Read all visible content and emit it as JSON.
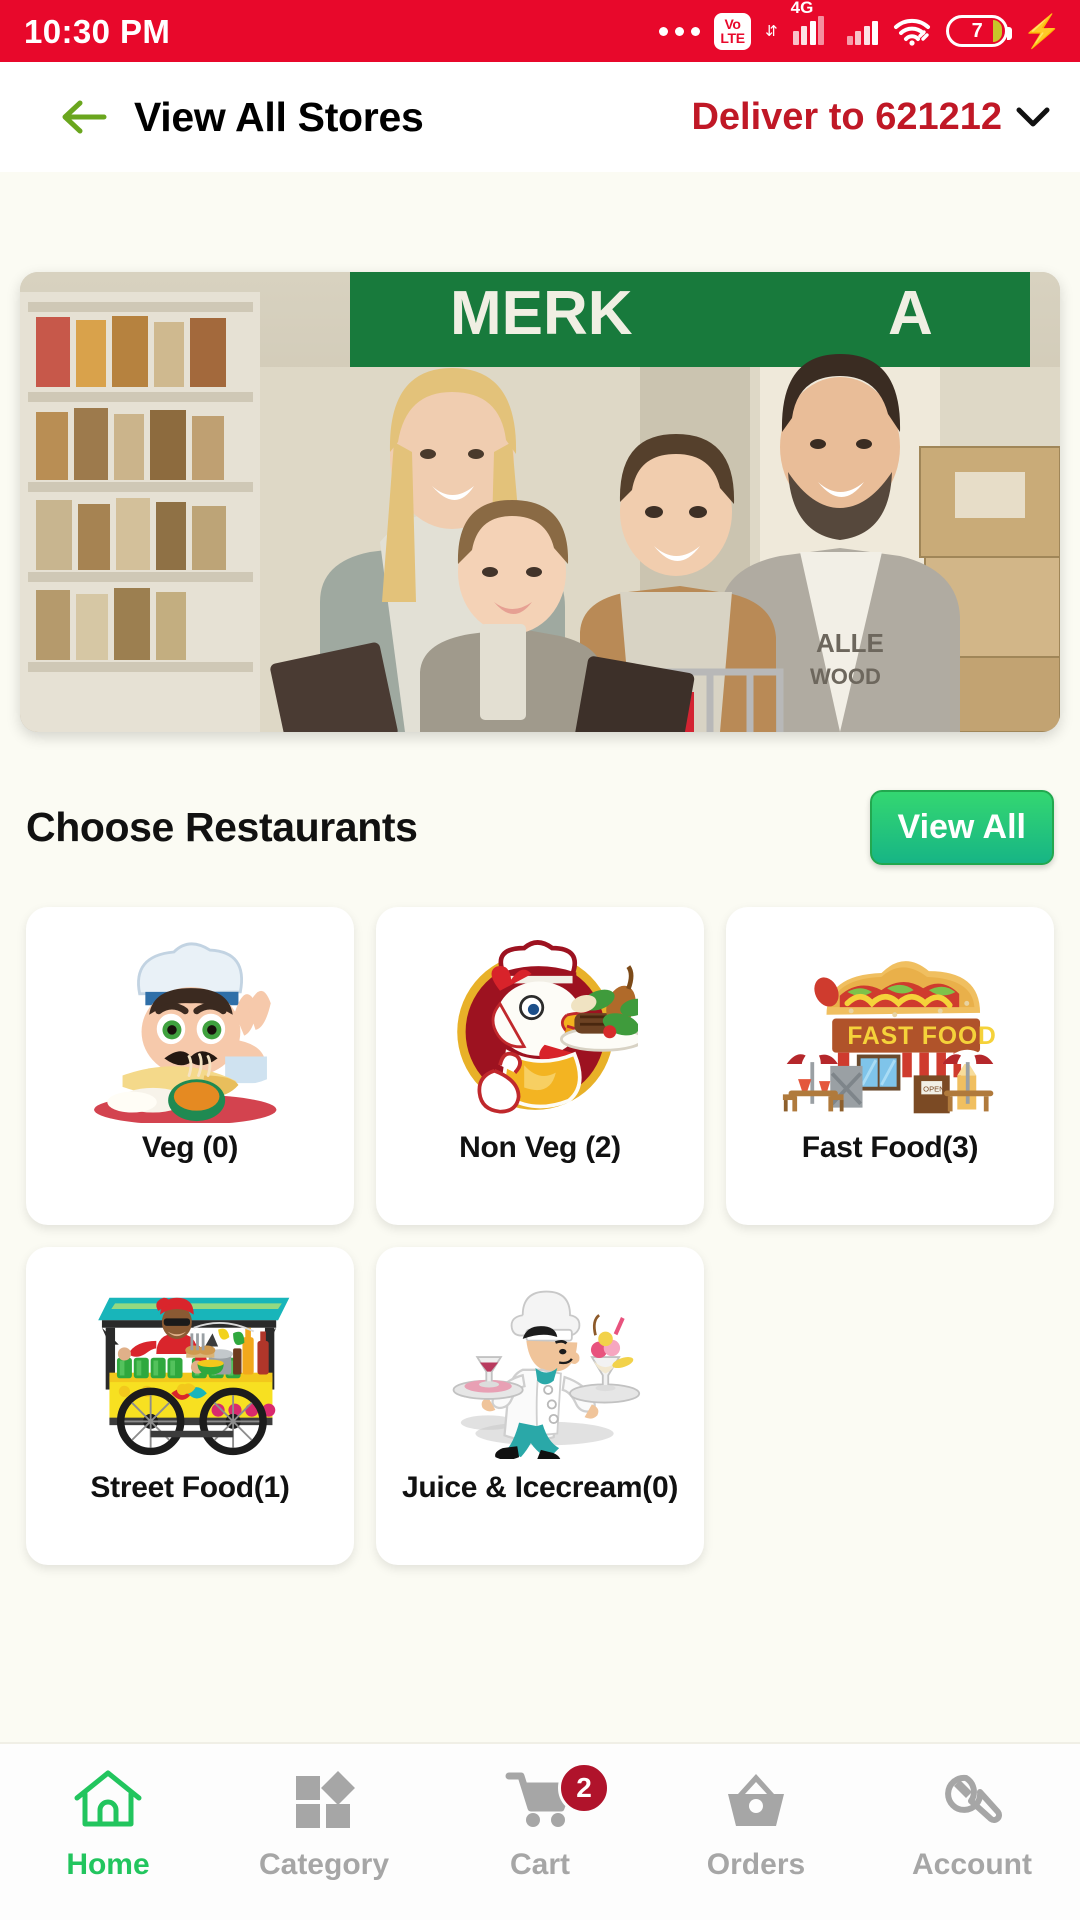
{
  "status_bar": {
    "time": "10:30 PM",
    "volte_top": "Vo",
    "volte_bottom": "LTE",
    "network_gen": "4G",
    "data_arrows": "⇵",
    "battery_level": "7",
    "icons": [
      "more-dots-icon",
      "volte-icon",
      "signal-4g-icon",
      "signal-icon",
      "wifi-link-icon",
      "battery-icon",
      "charging-bolt-icon"
    ],
    "accent": "#e8082b"
  },
  "header": {
    "back_icon": "arrow-left-icon",
    "title": "View All Stores",
    "deliver_label": "Deliver to 621212",
    "chevron_icon": "chevron-down-icon",
    "title_color": "#000000",
    "deliver_color": "#c01826",
    "back_arrow_color": "#6aa61e"
  },
  "banner": {
    "name": "promo-banner",
    "alt": "Family shopping with cart in a grocery store"
  },
  "section": {
    "title": "Choose Restaurants",
    "view_all_label": "View All",
    "view_all_color": "#22c55e"
  },
  "restaurants": [
    {
      "label": "Veg (0)",
      "icon": "chef-veg-icon",
      "count": 0
    },
    {
      "label": "Non Veg (2)",
      "icon": "chicken-chef-icon",
      "count": 2
    },
    {
      "label": "Fast Food(3)",
      "icon": "fast-food-stand-icon",
      "count": 3
    },
    {
      "label": "Street Food(1)",
      "icon": "street-food-cart-icon",
      "count": 1
    },
    {
      "label": "Juice & Icecream(0)",
      "icon": "waiter-drinks-icon",
      "count": 0
    }
  ],
  "bottom_nav": {
    "active_color": "#22c55e",
    "inactive_color": "#a6a6a6",
    "badge_color": "#b0132b",
    "items": [
      {
        "label": "Home",
        "icon": "home-icon",
        "active": true,
        "badge": ""
      },
      {
        "label": "Category",
        "icon": "grid-icon",
        "active": false,
        "badge": ""
      },
      {
        "label": "Cart",
        "icon": "cart-icon",
        "active": false,
        "badge": "2"
      },
      {
        "label": "Orders",
        "icon": "basket-icon",
        "active": false,
        "badge": ""
      },
      {
        "label": "Account",
        "icon": "wrench-icon",
        "active": false,
        "badge": ""
      }
    ]
  }
}
